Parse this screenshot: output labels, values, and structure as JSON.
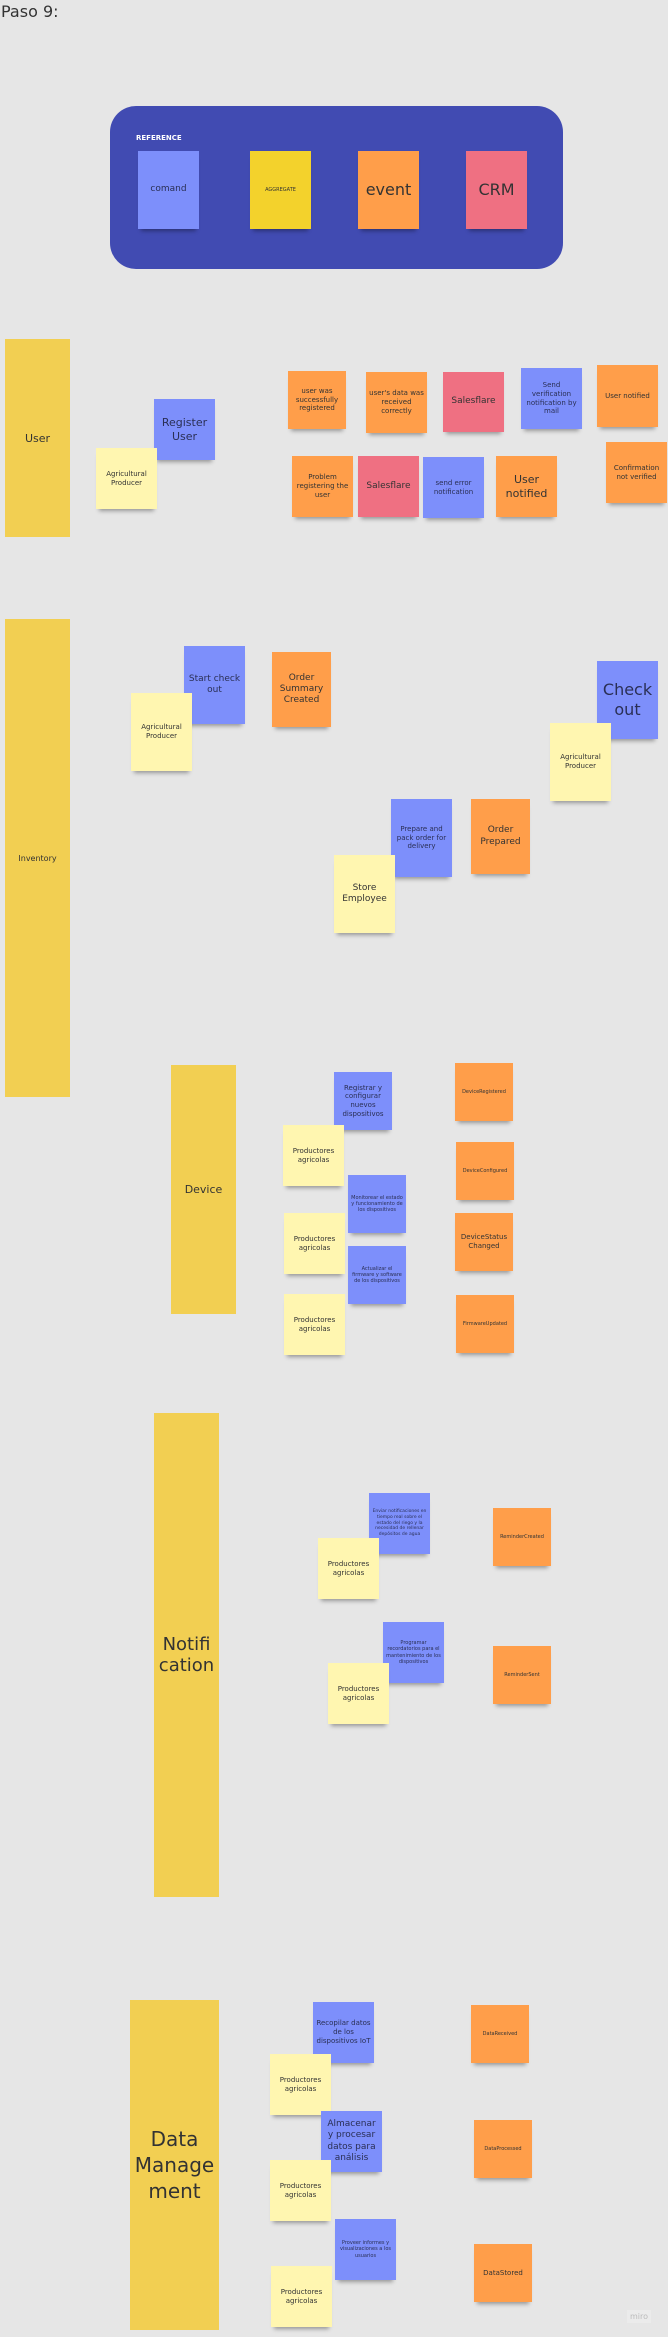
{
  "page_title": "Paso 9:",
  "reference": {
    "label": "REFERENCE",
    "command": "comand",
    "aggregate": "AGGREGATE",
    "event": "event",
    "crm": "CRM"
  },
  "colors": {
    "background": "#e6e6e6",
    "reference_box": "#414bb2",
    "command": "#7d8ffb",
    "event": "#ff9e4a",
    "crm": "#ef7082",
    "actor": "#fff6b0",
    "aggregate": "#f3d22c",
    "lane": "#f2cf52"
  },
  "lanes": {
    "user": {
      "label": "User",
      "notes": [
        "Agricultural Producer",
        "Register User",
        "user was successfully registered",
        "user's data was received correctly",
        "Salesflare",
        "Send verification notification by mail",
        "User notified",
        "Problem registering the user",
        "Salesflare",
        "send error notification",
        "User notified",
        "Confirmation not verified"
      ]
    },
    "inventory": {
      "label": "Inventory",
      "notes": [
        "Start check out",
        "Agricultural Producer",
        "Order Summary Created",
        "Check out",
        "Agricultural Producer",
        "Prepare and pack order for delivery",
        "Store Employee",
        "Order Prepared"
      ]
    },
    "device": {
      "label": "Device",
      "notes": [
        "Registrar y configurar nuevos dispositivos",
        "Productores agricolas",
        "Monitorear el estado y funcionamiento de los dispositivos",
        "Productores agricolas",
        "Actualizar el firmware y software de los dispositivos",
        "Productores agricolas",
        "DeviceRegistered",
        "DeviceConfigured",
        "DeviceStatus Changed",
        "FirmwareUpdated"
      ]
    },
    "notification": {
      "label": "Notifi cation",
      "notes": [
        "Enviar notificaciones en tiempo real sobre el estado del riego y la necesidad de rellenar depósitos de agua",
        "Productores agricolas",
        "Programar recordatorios para el mantenimiento de los dispositivos",
        "Productores agricolas",
        "ReminderCreated",
        "ReminderSent"
      ]
    },
    "data_management": {
      "label": "Data Manage ment",
      "notes": [
        "Recopilar datos de los dispositivos IoT",
        "Productores agricolas",
        "Almacenar y procesar datos para análisis",
        "Productores agricolas",
        "Proveer informes y visualizaciones a los usuarios",
        "Productores agricolas",
        "DataReceived",
        "DataProcessed",
        "DataStored"
      ]
    }
  },
  "watermark": "miro"
}
